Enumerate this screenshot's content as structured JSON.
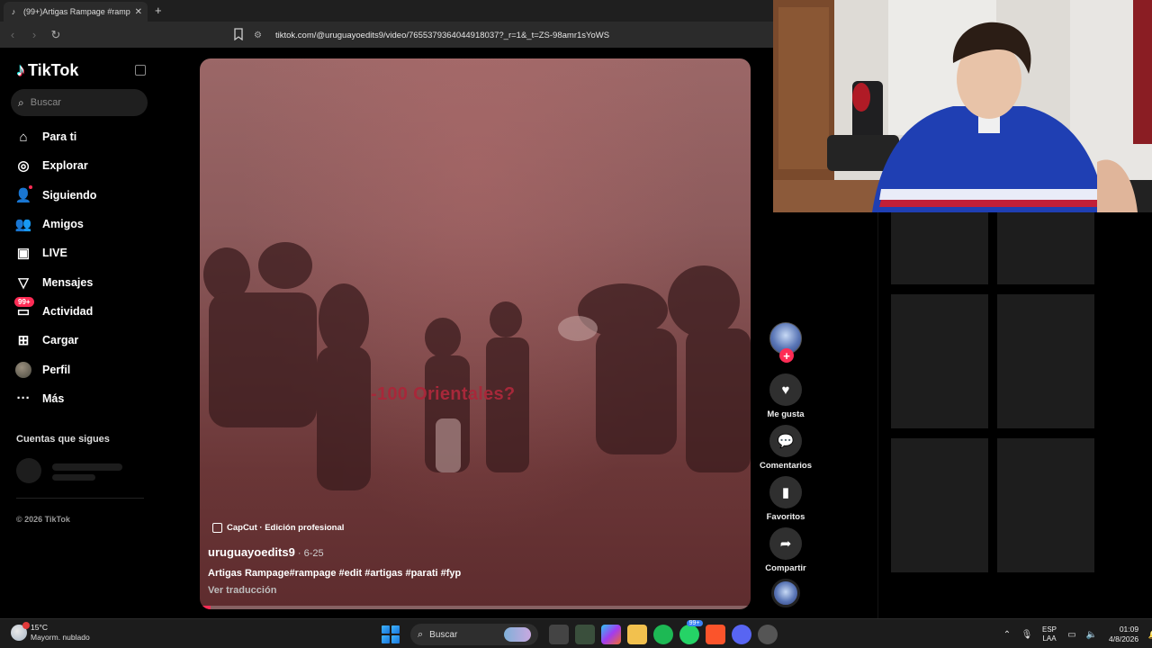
{
  "browser": {
    "tab_title": "(99+)Artigas Rampage #ramp",
    "tab_close": "✕",
    "new_tab": "+",
    "url": "tiktok.com/@uruguayoedits9/video/7655379364044918037?_r=1&_t=ZS-98amr1sYoWS"
  },
  "tiktok": {
    "logo_text": "TikTok",
    "search_placeholder": "Buscar",
    "nav": [
      {
        "label": "Para ti",
        "icon": "home-icon"
      },
      {
        "label": "Explorar",
        "icon": "compass-icon"
      },
      {
        "label": "Siguiendo",
        "icon": "following-icon"
      },
      {
        "label": "Amigos",
        "icon": "friends-icon"
      },
      {
        "label": "LIVE",
        "icon": "live-icon"
      },
      {
        "label": "Mensajes",
        "icon": "messages-icon"
      },
      {
        "label": "Actividad",
        "icon": "activity-icon",
        "badge": "99+"
      },
      {
        "label": "Cargar",
        "icon": "upload-icon"
      },
      {
        "label": "Perfil",
        "icon": "profile-avatar"
      },
      {
        "label": "Más",
        "icon": "more-icon"
      }
    ],
    "following_title": "Cuentas que sigues",
    "copyright": "© 2026 TikTok"
  },
  "video": {
    "overlay_text": "-100 Orientales?",
    "capcut_label": "CapCut · Edición profesional",
    "author": "uruguayoedits9",
    "date": " · 6-25",
    "description": "Artigas Rampage#rampage #edit #artigas #parati #fyp",
    "translate": "Ver traducción",
    "progress": 0.02,
    "accent": "#fe2c55"
  },
  "actions": {
    "like": "Me gusta",
    "comments": "Comentarios",
    "favorites": "Favoritos",
    "share": "Compartir"
  },
  "taskbar": {
    "temp": "15°C",
    "condition": "Mayorm. nublado",
    "search_placeholder": "Buscar",
    "whatsapp_badge": "99+",
    "lang_1": "ESP",
    "lang_2": "LAA",
    "time": "01:09",
    "date": "4/8/2026"
  }
}
